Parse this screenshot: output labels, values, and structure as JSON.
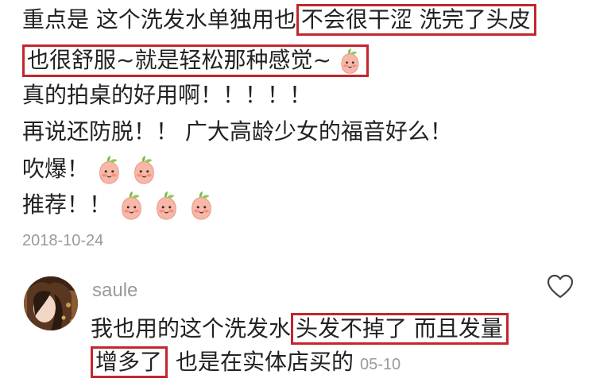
{
  "comment": {
    "line1_plain": "重点是 这个洗发水单独用也",
    "line1_highlight": "不会很干涩 洗完了头皮",
    "line2_highlight": "也很舒服~就是轻松那种感觉~",
    "line3": "真的拍桌的好用啊！！！！！",
    "line4": "再说还防脱！！ 广大高龄少女的福音好么！",
    "line5": "吹爆！",
    "line6": "推荐！！",
    "date": "2018-10-24"
  },
  "reply": {
    "username": "saule",
    "line1_plain": "我也用的这个洗发水",
    "line1_highlight": "头发不掉了 而且发量",
    "line2_highlight": "增多了",
    "line2_plain": "也是在实体店买的",
    "date": "05-10"
  },
  "icons": {
    "emoji": "peach-face-emoji",
    "like": "heart-outline-icon"
  },
  "colors": {
    "highlight_border": "#c1272d",
    "meta_text": "#9a9a9a",
    "body_text": "#222222"
  }
}
